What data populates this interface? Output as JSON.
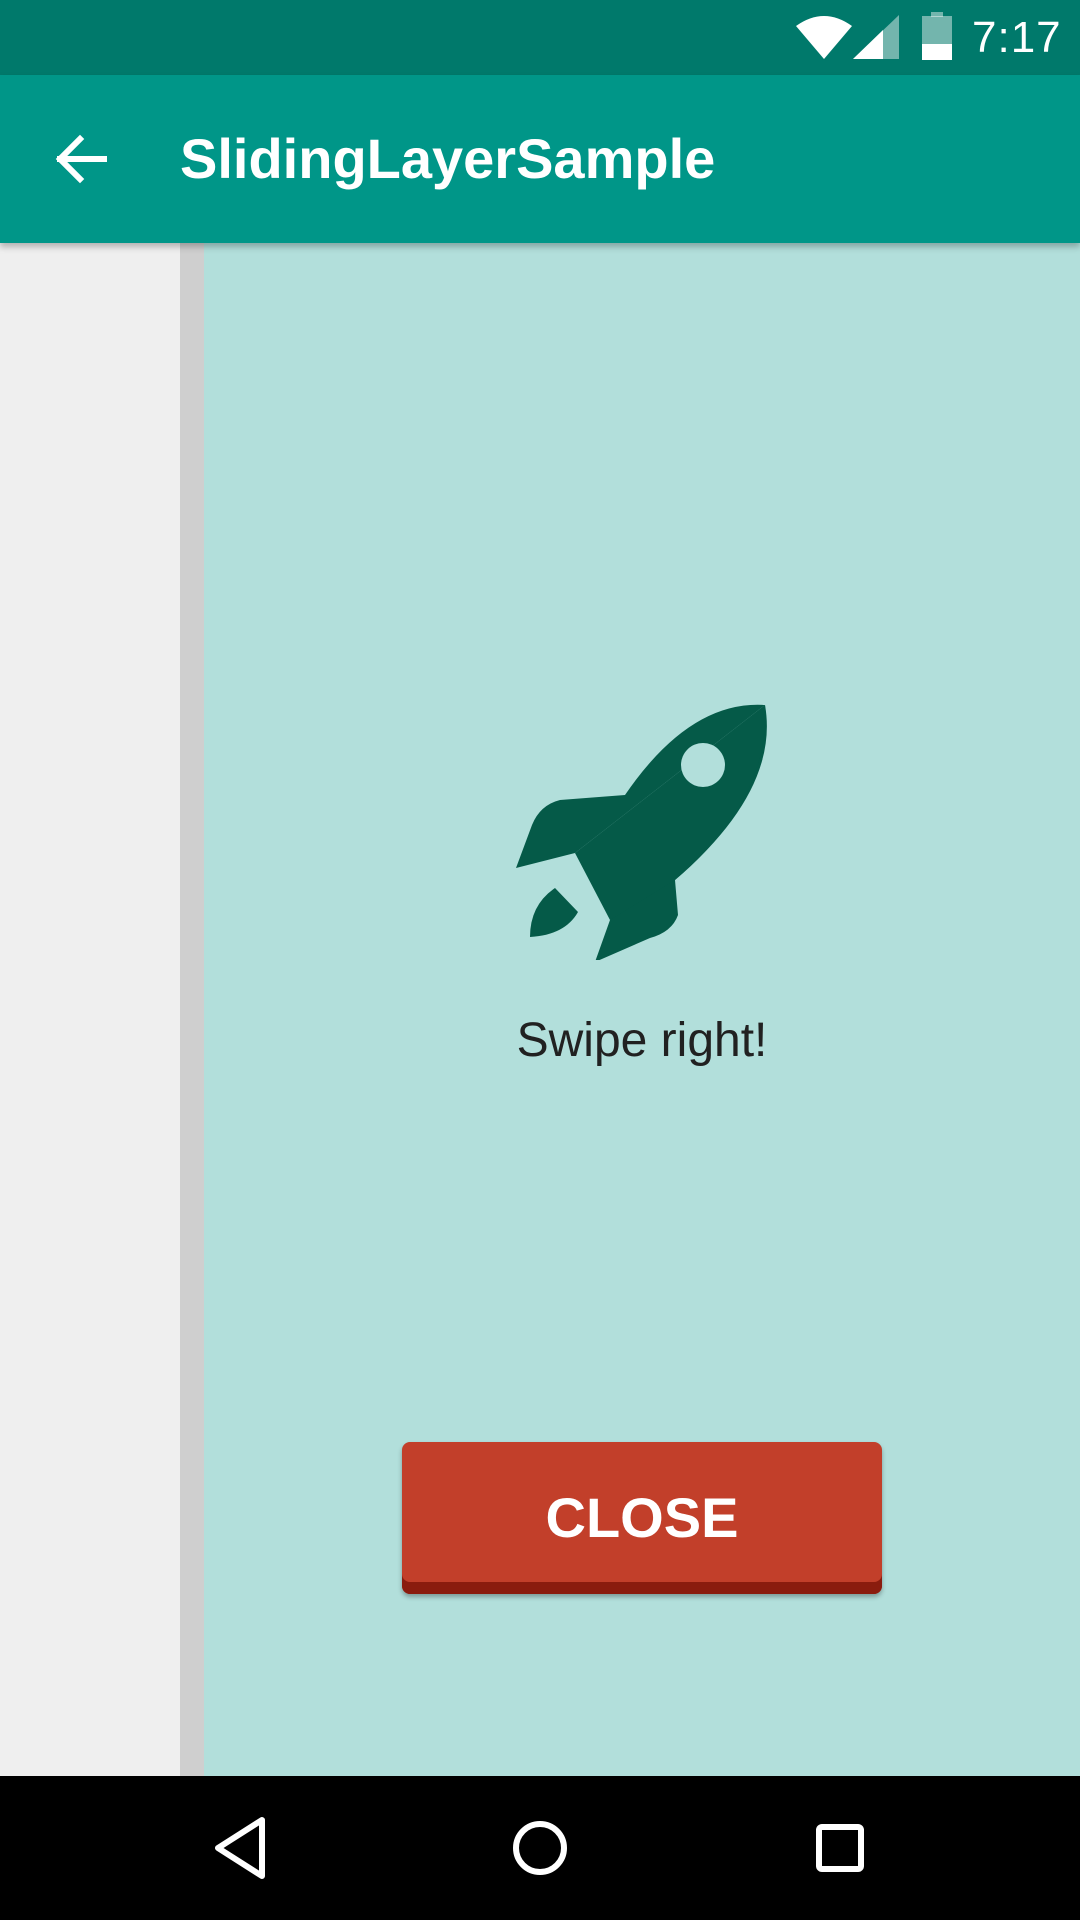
{
  "status_bar": {
    "time": "7:17",
    "icons": [
      "wifi-icon",
      "cell-signal-icon",
      "battery-icon"
    ]
  },
  "app_bar": {
    "title": "SlidingLayerSample",
    "nav_icon": "arrow-back-icon"
  },
  "sliding_layer": {
    "icon": "rocket-icon",
    "message": "Swipe right!",
    "close_label": "CLOSE"
  },
  "navigation_bar": {
    "buttons": [
      "back-triangle-icon",
      "home-circle-icon",
      "recents-square-icon"
    ]
  },
  "colors": {
    "status_bar": "#00796b",
    "app_bar": "#009688",
    "layer_background": "#b2dfdb",
    "layer_edge": "#cfcfcf",
    "underlay": "#efefef",
    "rocket": "#055a48",
    "close_button": "#c23f2a",
    "close_button_shadow": "#8a1c0e"
  }
}
